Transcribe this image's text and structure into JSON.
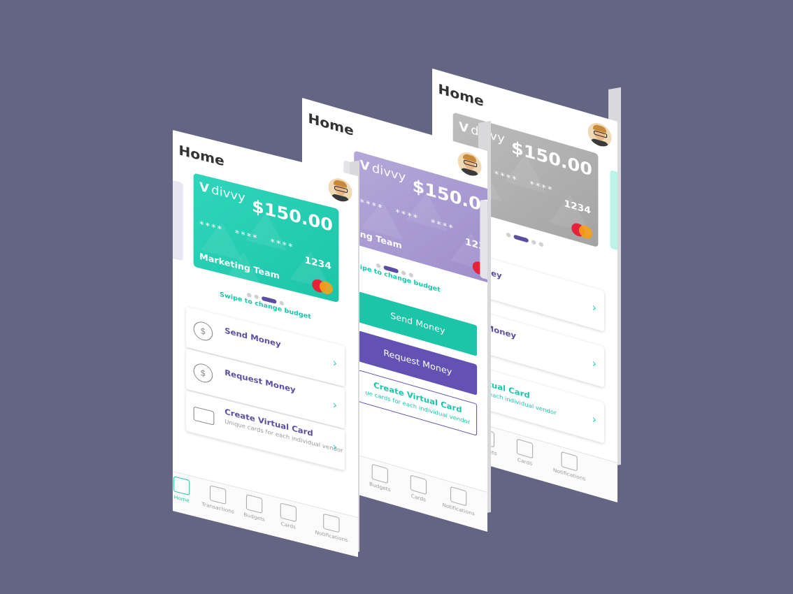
{
  "background": "#646583",
  "colors": {
    "teal": "#1cc4a8",
    "purple": "#6352b3",
    "grey": "#a4a4a4"
  },
  "screens": [
    {
      "id": "back",
      "title": "Home",
      "card": {
        "amount": "$150.00",
        "masked": "**** **** ****",
        "last4": "1234",
        "team": "",
        "logo": "divvy"
      },
      "actions": {
        "send": "end Money",
        "request": "equest Money",
        "create": "eate Virtual Card",
        "create_sub": "ue cards for each individual vendor"
      },
      "tabs": [
        "Budgets",
        "Cards",
        "Notifications"
      ]
    },
    {
      "id": "middle",
      "title": "Home",
      "card": {
        "amount": "$150.00",
        "masked": "**** **** ****",
        "last4": "1234",
        "team": "ng Team",
        "logo": "divvy"
      },
      "swipe": "Swipe to change budget",
      "actions": {
        "send": "Send Money",
        "request": "Request Money",
        "create": "Create Virtual Card",
        "create_sub": "ue cards for each individual vendor"
      },
      "tabs": [
        "m",
        "Budgets",
        "Cards",
        "Notifications"
      ]
    },
    {
      "id": "front",
      "title": "Home",
      "card": {
        "amount": "$150.00",
        "masked": "**** **** ****",
        "last4": "1234",
        "team": "Marketing Team",
        "logo": "divvy"
      },
      "swipe": "Swipe to change budget",
      "actions": {
        "send": "Send Money",
        "request": "Request Money",
        "create": "Create Virtual Card",
        "create_sub": "Unique cards for each individual vendor"
      },
      "tabs": [
        "Home",
        "Transactions",
        "Budgets",
        "Cards",
        "Notifications"
      ]
    }
  ]
}
